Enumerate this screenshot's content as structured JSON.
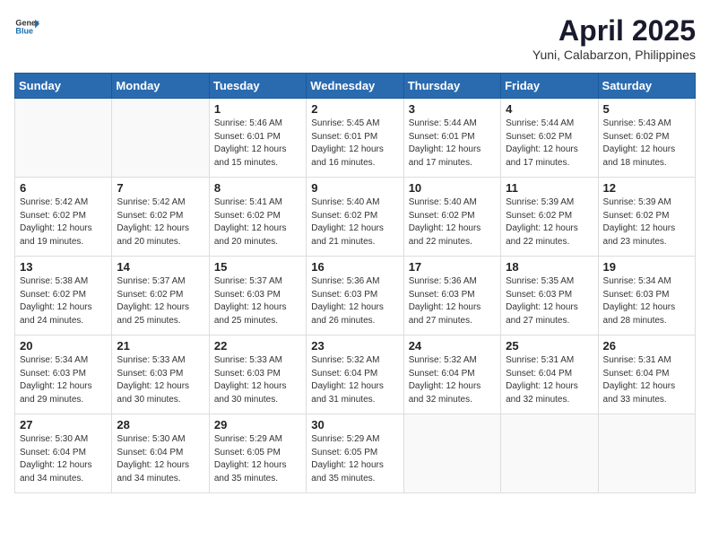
{
  "header": {
    "logo": {
      "general": "General",
      "blue": "Blue"
    },
    "title": "April 2025",
    "location": "Yuni, Calabarzon, Philippines"
  },
  "calendar": {
    "weekdays": [
      "Sunday",
      "Monday",
      "Tuesday",
      "Wednesday",
      "Thursday",
      "Friday",
      "Saturday"
    ],
    "weeks": [
      [
        {
          "day": "",
          "info": ""
        },
        {
          "day": "",
          "info": ""
        },
        {
          "day": "1",
          "info": "Sunrise: 5:46 AM\nSunset: 6:01 PM\nDaylight: 12 hours and 15 minutes."
        },
        {
          "day": "2",
          "info": "Sunrise: 5:45 AM\nSunset: 6:01 PM\nDaylight: 12 hours and 16 minutes."
        },
        {
          "day": "3",
          "info": "Sunrise: 5:44 AM\nSunset: 6:01 PM\nDaylight: 12 hours and 17 minutes."
        },
        {
          "day": "4",
          "info": "Sunrise: 5:44 AM\nSunset: 6:02 PM\nDaylight: 12 hours and 17 minutes."
        },
        {
          "day": "5",
          "info": "Sunrise: 5:43 AM\nSunset: 6:02 PM\nDaylight: 12 hours and 18 minutes."
        }
      ],
      [
        {
          "day": "6",
          "info": "Sunrise: 5:42 AM\nSunset: 6:02 PM\nDaylight: 12 hours and 19 minutes."
        },
        {
          "day": "7",
          "info": "Sunrise: 5:42 AM\nSunset: 6:02 PM\nDaylight: 12 hours and 20 minutes."
        },
        {
          "day": "8",
          "info": "Sunrise: 5:41 AM\nSunset: 6:02 PM\nDaylight: 12 hours and 20 minutes."
        },
        {
          "day": "9",
          "info": "Sunrise: 5:40 AM\nSunset: 6:02 PM\nDaylight: 12 hours and 21 minutes."
        },
        {
          "day": "10",
          "info": "Sunrise: 5:40 AM\nSunset: 6:02 PM\nDaylight: 12 hours and 22 minutes."
        },
        {
          "day": "11",
          "info": "Sunrise: 5:39 AM\nSunset: 6:02 PM\nDaylight: 12 hours and 22 minutes."
        },
        {
          "day": "12",
          "info": "Sunrise: 5:39 AM\nSunset: 6:02 PM\nDaylight: 12 hours and 23 minutes."
        }
      ],
      [
        {
          "day": "13",
          "info": "Sunrise: 5:38 AM\nSunset: 6:02 PM\nDaylight: 12 hours and 24 minutes."
        },
        {
          "day": "14",
          "info": "Sunrise: 5:37 AM\nSunset: 6:02 PM\nDaylight: 12 hours and 25 minutes."
        },
        {
          "day": "15",
          "info": "Sunrise: 5:37 AM\nSunset: 6:03 PM\nDaylight: 12 hours and 25 minutes."
        },
        {
          "day": "16",
          "info": "Sunrise: 5:36 AM\nSunset: 6:03 PM\nDaylight: 12 hours and 26 minutes."
        },
        {
          "day": "17",
          "info": "Sunrise: 5:36 AM\nSunset: 6:03 PM\nDaylight: 12 hours and 27 minutes."
        },
        {
          "day": "18",
          "info": "Sunrise: 5:35 AM\nSunset: 6:03 PM\nDaylight: 12 hours and 27 minutes."
        },
        {
          "day": "19",
          "info": "Sunrise: 5:34 AM\nSunset: 6:03 PM\nDaylight: 12 hours and 28 minutes."
        }
      ],
      [
        {
          "day": "20",
          "info": "Sunrise: 5:34 AM\nSunset: 6:03 PM\nDaylight: 12 hours and 29 minutes."
        },
        {
          "day": "21",
          "info": "Sunrise: 5:33 AM\nSunset: 6:03 PM\nDaylight: 12 hours and 30 minutes."
        },
        {
          "day": "22",
          "info": "Sunrise: 5:33 AM\nSunset: 6:03 PM\nDaylight: 12 hours and 30 minutes."
        },
        {
          "day": "23",
          "info": "Sunrise: 5:32 AM\nSunset: 6:04 PM\nDaylight: 12 hours and 31 minutes."
        },
        {
          "day": "24",
          "info": "Sunrise: 5:32 AM\nSunset: 6:04 PM\nDaylight: 12 hours and 32 minutes."
        },
        {
          "day": "25",
          "info": "Sunrise: 5:31 AM\nSunset: 6:04 PM\nDaylight: 12 hours and 32 minutes."
        },
        {
          "day": "26",
          "info": "Sunrise: 5:31 AM\nSunset: 6:04 PM\nDaylight: 12 hours and 33 minutes."
        }
      ],
      [
        {
          "day": "27",
          "info": "Sunrise: 5:30 AM\nSunset: 6:04 PM\nDaylight: 12 hours and 34 minutes."
        },
        {
          "day": "28",
          "info": "Sunrise: 5:30 AM\nSunset: 6:04 PM\nDaylight: 12 hours and 34 minutes."
        },
        {
          "day": "29",
          "info": "Sunrise: 5:29 AM\nSunset: 6:05 PM\nDaylight: 12 hours and 35 minutes."
        },
        {
          "day": "30",
          "info": "Sunrise: 5:29 AM\nSunset: 6:05 PM\nDaylight: 12 hours and 35 minutes."
        },
        {
          "day": "",
          "info": ""
        },
        {
          "day": "",
          "info": ""
        },
        {
          "day": "",
          "info": ""
        }
      ]
    ]
  }
}
